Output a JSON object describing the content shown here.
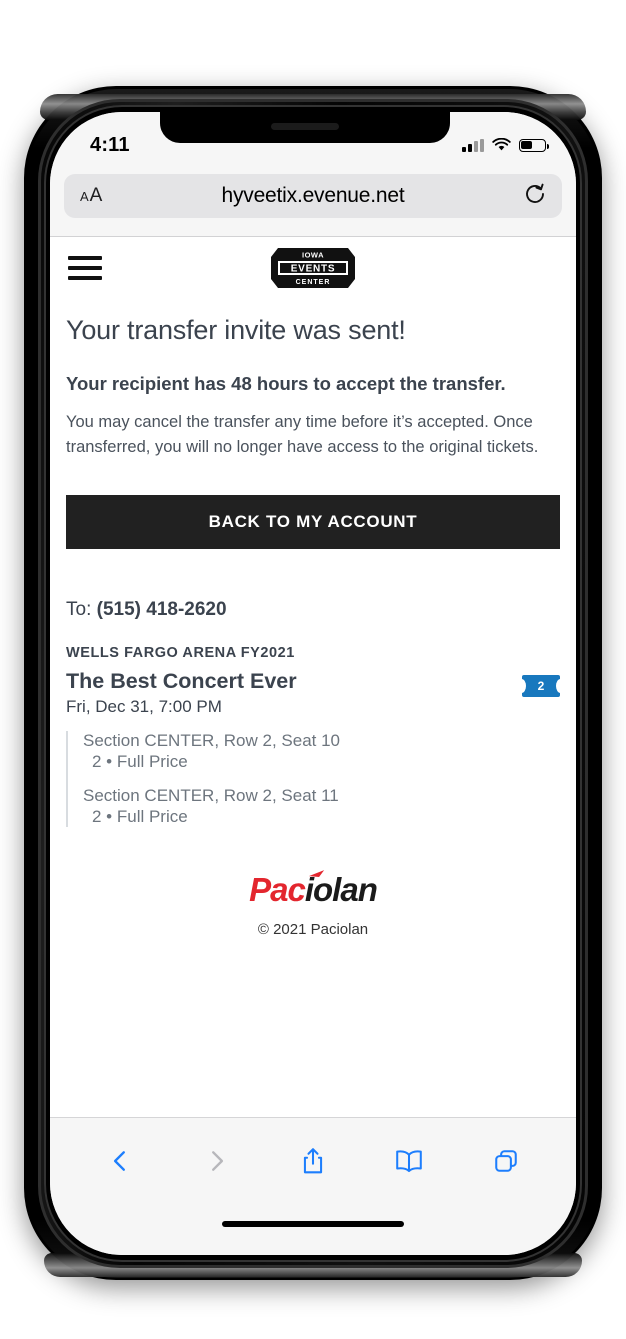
{
  "device": {
    "status_bar": {
      "time": "4:11",
      "signal_icon": "cellular-signal-icon",
      "wifi_icon": "wifi-icon",
      "battery_icon": "battery-icon",
      "battery_level_percent": 47
    },
    "home_indicator": "home-indicator"
  },
  "browser": {
    "name": "Safari",
    "url": "hyveetix.evenue.net",
    "text_size_label": "AA",
    "reload_icon": "reload-icon",
    "toolbar": {
      "back_icon": "chevron-left-icon",
      "forward_icon": "chevron-right-icon",
      "share_icon": "share-icon",
      "bookmarks_icon": "book-icon",
      "tabs_icon": "tabs-icon",
      "back_enabled": true,
      "forward_enabled": false,
      "accent_color": "#1d7efd",
      "disabled_color": "#b7b7bb"
    }
  },
  "site": {
    "menu_icon": "hamburger-menu-icon",
    "logo": {
      "name": "iowa-events-center-logo",
      "line1": "IOWA",
      "line2": "EVENTS",
      "line3": "CENTER"
    }
  },
  "main": {
    "title": "Your transfer invite was sent!",
    "lede": "Your recipient has 48 hours to accept the transfer.",
    "body": "You may cancel the transfer any time before it’s accepted. Once transferred, you will no longer have access to the original tickets.",
    "primary_button": "BACK TO MY ACCOUNT",
    "recipient": {
      "label": "To:",
      "value": "(515) 418-2620"
    }
  },
  "event": {
    "venue": "WELLS FARGO ARENA FY2021",
    "name": "The Best Concert Ever",
    "date": "Fri, Dec 31, 7:00 PM",
    "ticket_count_badge": "2",
    "ticket_badge_color": "#1878be",
    "seats": [
      {
        "location": "Section CENTER, Row 2, Seat 10",
        "detail": "2 • Full Price"
      },
      {
        "location": "Section CENTER, Row 2, Seat 11",
        "detail": "2 • Full Price"
      }
    ]
  },
  "footer": {
    "logo_part1": "Pac",
    "logo_part2": "iolan",
    "logo_color_primary": "#e3262e",
    "logo_color_secondary": "#1b1b1b",
    "copyright": "© 2021 Paciolan"
  }
}
